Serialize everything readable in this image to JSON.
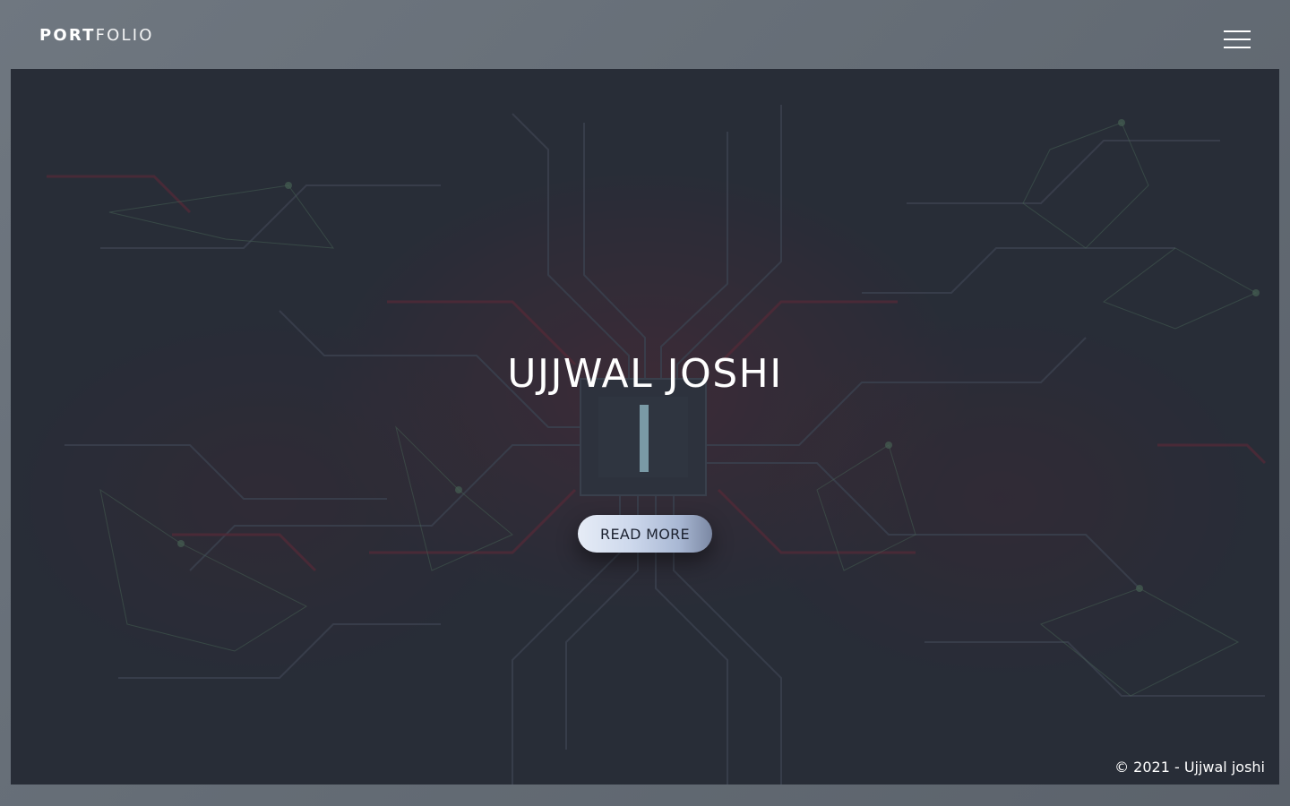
{
  "header": {
    "logo_bold": "PORT",
    "logo_light": "FOLIO",
    "menu_icon": "hamburger-menu-icon"
  },
  "hero": {
    "title": "UJJWAL JOSHI",
    "button_label": "READ MORE",
    "background": "circuit-board-network-image"
  },
  "footer": {
    "copyright": "© 2021 - Ujjwal joshi"
  },
  "colors": {
    "page_background": "#646c75",
    "hero_tint": "#2a303a",
    "accent_red": "#7a2a3a",
    "network_green": "#5f8a6a",
    "text": "#ffffff"
  }
}
